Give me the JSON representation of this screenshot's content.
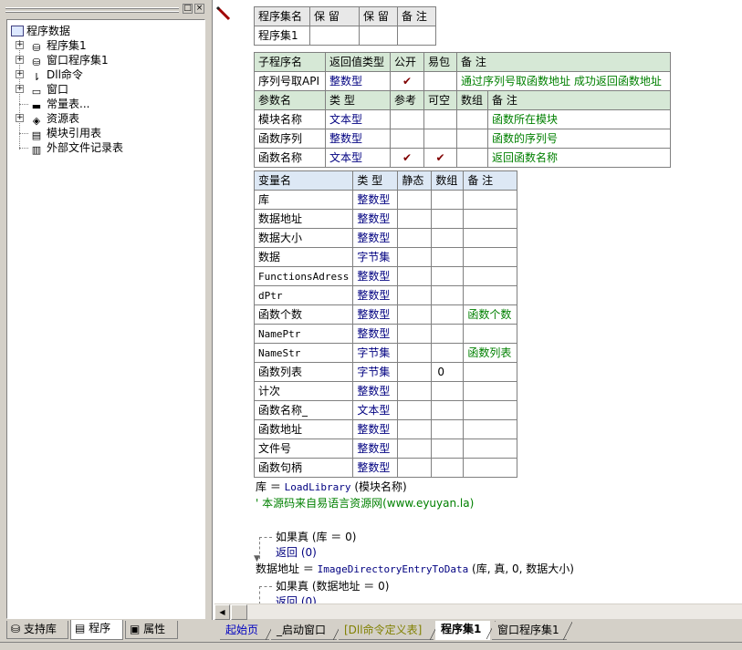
{
  "tree": {
    "root": "程序数据",
    "items": [
      {
        "label": "程序集1",
        "icon": "assembly-icon",
        "expander": "+"
      },
      {
        "label": "窗口程序集1",
        "icon": "assembly-icon",
        "expander": "+"
      },
      {
        "label": "Dll命令",
        "icon": "dll-icon",
        "expander": "+"
      },
      {
        "label": "窗口",
        "icon": "window-icon",
        "expander": "+"
      },
      {
        "label": "常量表...",
        "icon": "constant-icon",
        "expander": ""
      },
      {
        "label": "资源表",
        "icon": "resource-icon",
        "expander": "+"
      },
      {
        "label": "模块引用表",
        "icon": "module-icon",
        "expander": ""
      },
      {
        "label": "外部文件记录表",
        "icon": "file-icon",
        "expander": ""
      }
    ]
  },
  "left_tabs": [
    {
      "label": "支持库",
      "active": false
    },
    {
      "label": "程序",
      "active": true
    },
    {
      "label": "属性",
      "active": false
    }
  ],
  "titlebar_buttons": {
    "restore": "□",
    "close": "×"
  },
  "assembly_table": {
    "headers": [
      "程序集名",
      "保 留",
      "保 留",
      "备 注"
    ],
    "row": [
      "程序集1",
      "",
      "",
      ""
    ]
  },
  "sub_table": {
    "headers": [
      "子程序名",
      "返回值类型",
      "公开",
      "易包",
      "备 注"
    ],
    "row": {
      "name": "序列号取API",
      "type": "整数型",
      "public": "✔",
      "pack": "",
      "note": "通过序列号取函数地址 成功返回函数地址"
    },
    "param_headers": [
      "参数名",
      "类 型",
      "参考",
      "可空",
      "数组",
      "备 注"
    ],
    "params": [
      {
        "name": "模块名称",
        "type": "文本型",
        "ref": "",
        "nullable": "",
        "array": "",
        "note": "函数所在模块"
      },
      {
        "name": "函数序列",
        "type": "整数型",
        "ref": "",
        "nullable": "",
        "array": "",
        "note": "函数的序列号"
      },
      {
        "name": "函数名称",
        "type": "文本型",
        "ref": "✔",
        "nullable": "✔",
        "array": "",
        "note": "返回函数名称"
      }
    ]
  },
  "var_table": {
    "headers": [
      "变量名",
      "类 型",
      "静态",
      "数组",
      "备 注"
    ],
    "rows": [
      {
        "name": "库",
        "type": "整数型",
        "static": "",
        "array": "",
        "note": ""
      },
      {
        "name": "数据地址",
        "type": "整数型",
        "static": "",
        "array": "",
        "note": ""
      },
      {
        "name": "数据大小",
        "type": "整数型",
        "static": "",
        "array": "",
        "note": ""
      },
      {
        "name": "数据",
        "type": "字节集",
        "static": "",
        "array": "",
        "note": ""
      },
      {
        "name": "FunctionsAdress",
        "type": "整数型",
        "static": "",
        "array": "",
        "note": ""
      },
      {
        "name": "dPtr",
        "type": "整数型",
        "static": "",
        "array": "",
        "note": ""
      },
      {
        "name": "函数个数",
        "type": "整数型",
        "static": "",
        "array": "",
        "note": "函数个数"
      },
      {
        "name": "NamePtr",
        "type": "整数型",
        "static": "",
        "array": "",
        "note": ""
      },
      {
        "name": "NameStr",
        "type": "字节集",
        "static": "",
        "array": "",
        "note": "函数列表"
      },
      {
        "name": "函数列表",
        "type": "字节集",
        "static": "",
        "array": "0",
        "note": ""
      },
      {
        "name": "计次",
        "type": "整数型",
        "static": "",
        "array": "",
        "note": ""
      },
      {
        "name": "函数名称_",
        "type": "文本型",
        "static": "",
        "array": "",
        "note": ""
      },
      {
        "name": "函数地址",
        "type": "整数型",
        "static": "",
        "array": "",
        "note": ""
      },
      {
        "name": "文件号",
        "type": "整数型",
        "static": "",
        "array": "",
        "note": ""
      },
      {
        "name": "函数句柄",
        "type": "整数型",
        "static": "",
        "array": "",
        "note": ""
      }
    ]
  },
  "code": {
    "line1_pre": "库 ＝ ",
    "line1_fn": "LoadLibrary",
    "line1_post": " (模块名称)",
    "comment": "' 本源码来自易语言资源网(www.eyuyan.la)",
    "if1": "如果真 (库 ＝ 0)",
    "ret1": "返回 (0)",
    "line2_pre": "数据地址 ＝ ",
    "line2_fn": "ImageDirectoryEntryToData",
    "line2_post": " (库, 真, 0, 数据大小)",
    "if2": "如果真 (数据地址 ＝ 0)",
    "ret2": "返回 (0)"
  },
  "bottom_tabs": [
    {
      "label": "起始页",
      "active": false,
      "style": "blue"
    },
    {
      "label": "_启动窗口",
      "active": false,
      "style": "normal"
    },
    {
      "label": "[Dll命令定义表]",
      "active": false,
      "style": "olive"
    },
    {
      "label": "程序集1",
      "active": true,
      "style": "normal"
    },
    {
      "label": "窗口程序集1",
      "active": false,
      "style": "normal"
    }
  ],
  "colors": {
    "type_blue": "#000080",
    "note_green": "#008000",
    "check_red": "#800000",
    "header_green": "#d6e8d6"
  }
}
